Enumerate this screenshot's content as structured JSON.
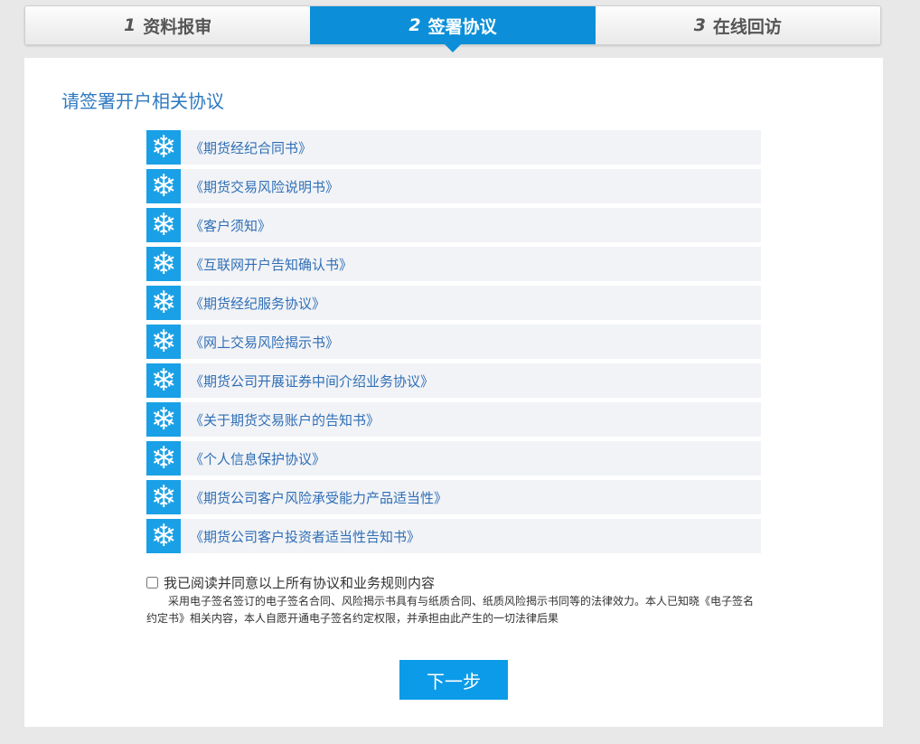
{
  "steps": [
    {
      "num": "1",
      "label": "资料报审"
    },
    {
      "num": "2",
      "label": "签署协议"
    },
    {
      "num": "3",
      "label": "在线回访"
    }
  ],
  "panel": {
    "title": "请签署开户相关协议"
  },
  "agreements": [
    "《期货经纪合同书》",
    "《期货交易风险说明书》",
    "《客户须知》",
    "《互联网开户告知确认书》",
    "《期货经纪服务协议》",
    "《网上交易风险揭示书》",
    "《期货公司开展证券中间介绍业务协议》",
    "《关于期货交易账户的告知书》",
    "《个人信息保护协议》",
    "《期货公司客户风险承受能力产品适当性》",
    "《期货公司客户投资者适当性告知书》"
  ],
  "consent": {
    "label": "我已阅读并同意以上所有协议和业务规则内容",
    "note": "采用电子签名签订的电子签名合同、风险揭示书具有与纸质合同、纸质风险揭示书同等的法律效力。本人已知晓《电子签名约定书》相关内容，本人自愿开通电子签名约定权限，并承担由此产生的一切法律后果"
  },
  "next_button": "下一步",
  "colors": {
    "accent": "#0c8fd8",
    "link": "#2f6fb7",
    "title": "#2f79c0"
  }
}
